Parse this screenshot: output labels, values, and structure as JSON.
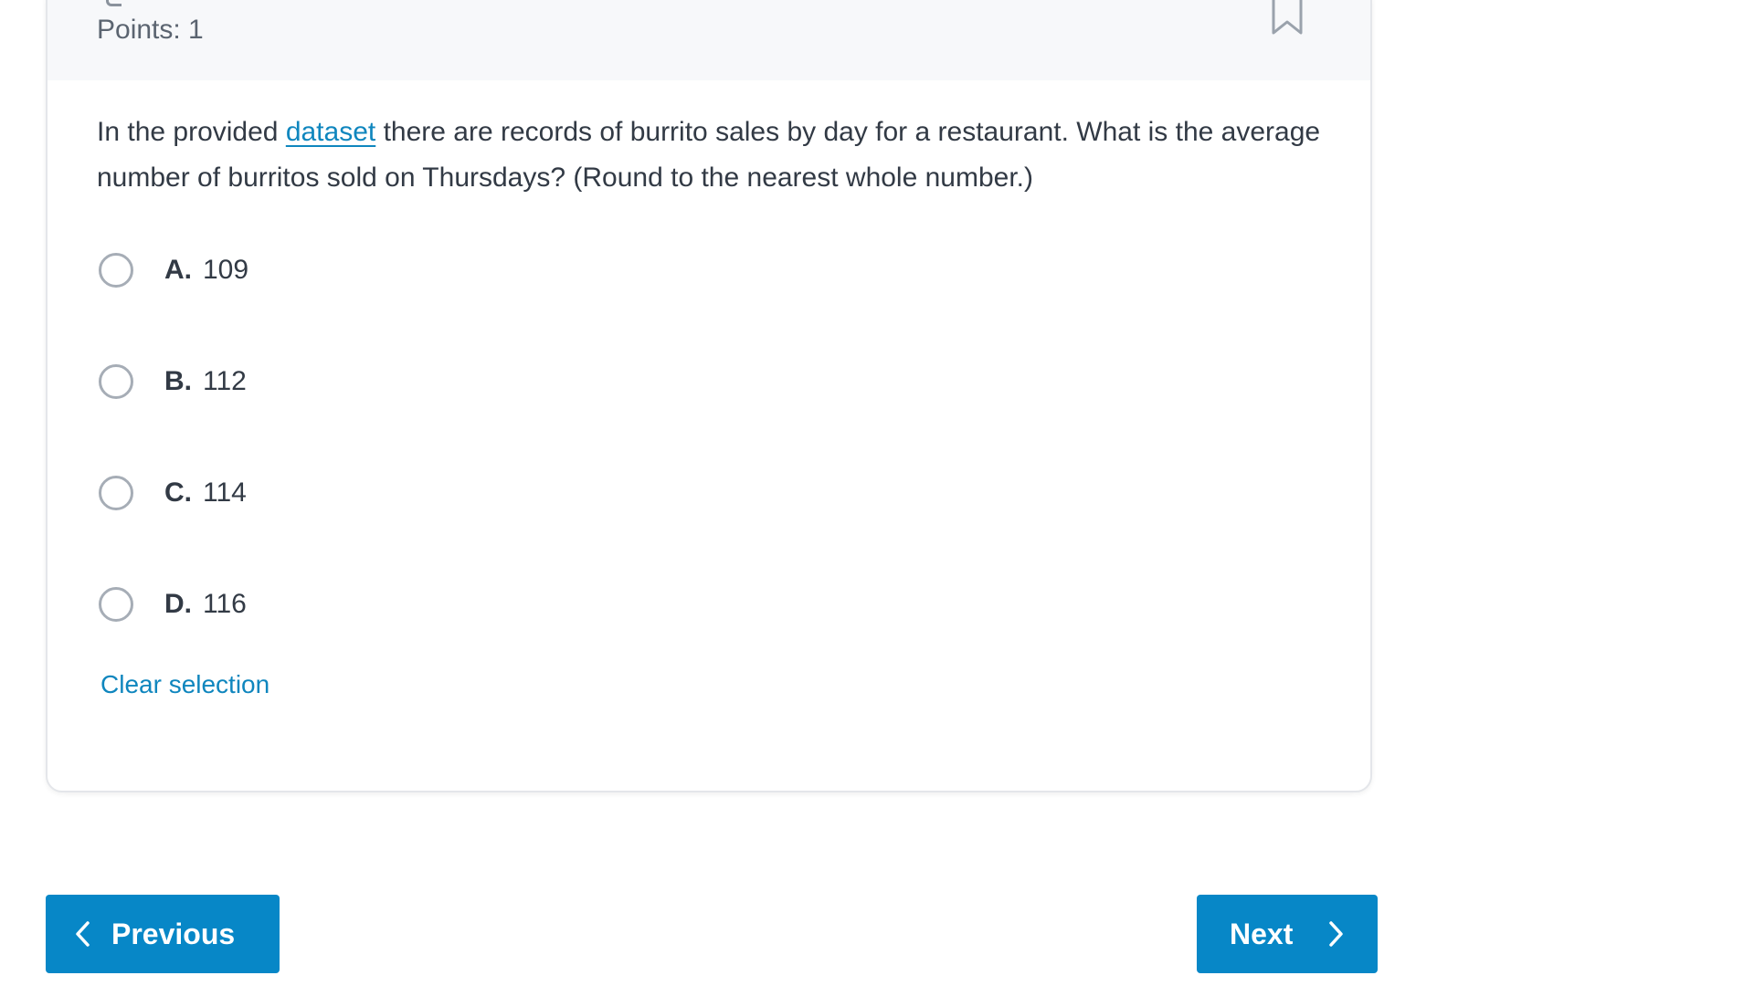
{
  "question": {
    "points_label": "Points: 1",
    "text_before_link": "In the provided ",
    "link_text": "dataset",
    "text_after_link": " there are records of burrito sales by day for a restaurant. What is the average number of burritos sold on Thursdays? (Round to the nearest whole number.)"
  },
  "options": [
    {
      "letter": "A.",
      "value": "109"
    },
    {
      "letter": "B.",
      "value": "112"
    },
    {
      "letter": "C.",
      "value": "114"
    },
    {
      "letter": "D.",
      "value": "116"
    }
  ],
  "clear_selection_label": "Clear selection",
  "navigation": {
    "previous_label": "Previous",
    "next_label": "Next"
  },
  "icons": {
    "bookmark": "bookmark-icon",
    "previous": "chevron-left-icon",
    "next": "chevron-right-icon"
  },
  "colors": {
    "accent": "#0787c7",
    "link": "#0f86be",
    "text": "#323a45",
    "header_bg": "#f7f8fa"
  }
}
